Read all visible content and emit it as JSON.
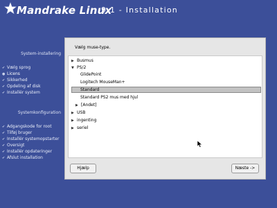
{
  "header": {
    "brand": "Mandrake Linux",
    "version_title": "9.1 - Installation"
  },
  "sidebar": {
    "install_heading": "System-installering",
    "install_steps": [
      {
        "label": "Vælg sprog",
        "state": "done"
      },
      {
        "label": "Licens",
        "state": "current"
      },
      {
        "label": "Sikkerhed",
        "state": "pending"
      },
      {
        "label": "Opdeling af disk",
        "state": "pending"
      },
      {
        "label": "Installér system",
        "state": "pending"
      }
    ],
    "config_heading": "Systemkonfiguration",
    "config_steps": [
      {
        "label": "Adgangskode for root",
        "state": "pending"
      },
      {
        "label": "Tilføj bruger",
        "state": "pending"
      },
      {
        "label": "Installér systemopstarter",
        "state": "pending"
      },
      {
        "label": "Oversigt",
        "state": "pending"
      },
      {
        "label": "Installér opdateringer",
        "state": "pending"
      },
      {
        "label": "Afslut installation",
        "state": "pending"
      }
    ]
  },
  "dialog": {
    "prompt": "Vælg muse-type.",
    "tree": [
      {
        "label": "Busmus",
        "level": 0,
        "expander": "collapsed"
      },
      {
        "label": "PS/2",
        "level": 0,
        "expander": "expanded"
      },
      {
        "label": "GlidePoint",
        "level": 1,
        "expander": "none"
      },
      {
        "label": "Logitech MouseMan+",
        "level": 1,
        "expander": "none"
      },
      {
        "label": "Standard",
        "level": 1,
        "expander": "none",
        "selected": true
      },
      {
        "label": "Standard PS2 mus med hjul",
        "level": 1,
        "expander": "none"
      },
      {
        "label": "[Andet]",
        "level": 1,
        "expander": "collapsed"
      },
      {
        "label": "USB",
        "level": 0,
        "expander": "collapsed"
      },
      {
        "label": "ingenting",
        "level": 0,
        "expander": "collapsed"
      },
      {
        "label": "seriel",
        "level": 0,
        "expander": "collapsed"
      }
    ],
    "help_button": "Hjælp",
    "next_button": "Næste ->"
  },
  "icons": {
    "logo": "mandrake-star-icon",
    "collapsed": "triangle-right-icon",
    "expanded": "triangle-down-icon",
    "cursor": "mouse-pointer-icon"
  },
  "colors": {
    "background": "#3c4f99",
    "panel": "#e6e6e6",
    "listbox": "#ffffff",
    "selection": "#c2c2c2"
  }
}
